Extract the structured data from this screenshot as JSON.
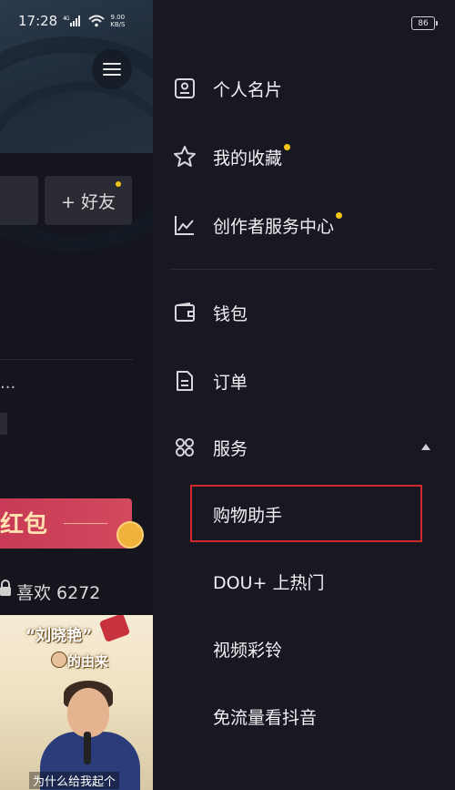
{
  "status": {
    "time": "17:28",
    "signal": "4G",
    "net_speed_value": "9.00",
    "net_speed_unit": "KB/S",
    "battery": "86"
  },
  "background_page": {
    "add_friend": "+ 好友",
    "ellipsis": "...",
    "banner_text": "红包",
    "likes_label": "喜欢 6272",
    "video": {
      "title": "“刘晓艳”",
      "subtitle": "的由来",
      "caption": "为什么给我起个"
    }
  },
  "drawer": {
    "items": [
      {
        "label": "个人名片",
        "icon": "id-card-icon"
      },
      {
        "label": "我的收藏",
        "icon": "star-icon",
        "dot": true
      },
      {
        "label": "创作者服务中心",
        "icon": "chart-icon",
        "dot": true
      },
      {
        "label": "钱包",
        "icon": "wallet-icon"
      },
      {
        "label": "订单",
        "icon": "document-icon"
      },
      {
        "label": "服务",
        "icon": "grid-icon",
        "expanded": true
      }
    ],
    "services": [
      "购物助手",
      "DOU+ 上热门",
      "视频彩铃",
      "免流量看抖音"
    ],
    "dot_color": "#f5c518",
    "highlight_color": "#d22a2a"
  }
}
